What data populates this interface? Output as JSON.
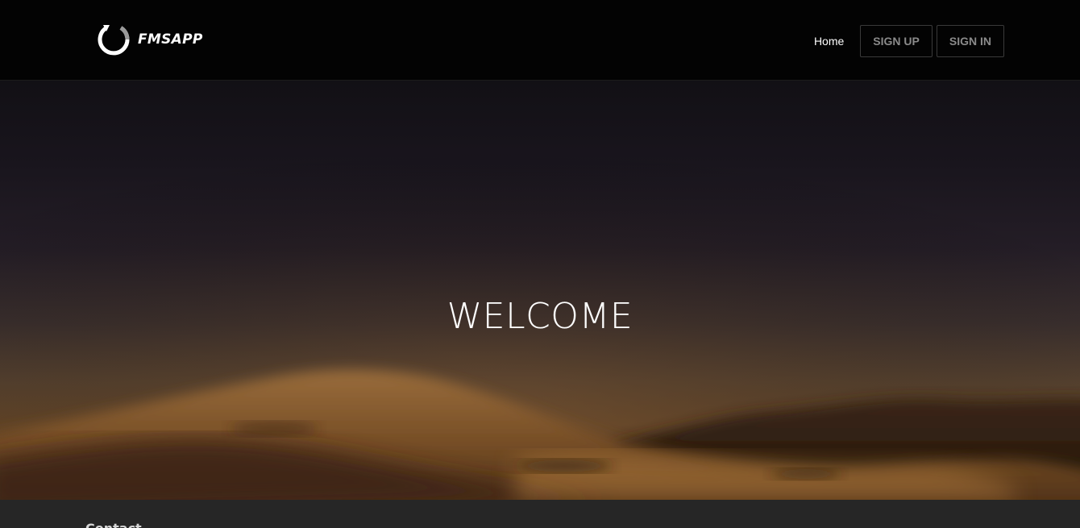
{
  "header": {
    "brand_name": "FMSAPP",
    "nav": {
      "home_label": "Home",
      "signup_label": "SIGN UP",
      "signin_label": "SIGN IN"
    }
  },
  "hero": {
    "title": "WELCOME",
    "background": "blurred desert dunes at dusk"
  },
  "footer": {
    "heading": "Contact"
  },
  "colors": {
    "navbar_bg": "#030303",
    "button_text": "#8a8a8a",
    "footer_bg": "#262626"
  },
  "icons": {
    "brand_logo": "circular-arrow-logo-icon"
  }
}
